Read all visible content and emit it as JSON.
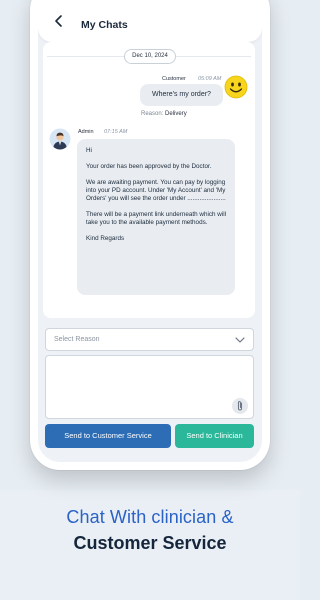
{
  "header": {
    "title": "My Chats",
    "back_icon": "chevron-left-icon"
  },
  "chat": {
    "date": "Dec 10, 2024",
    "customer_message": {
      "sender": "Customer",
      "time": "05:09 AM",
      "text": "Where's my order?",
      "reason_label": "Reason:",
      "reason_value": "Delivery",
      "avatar_icon": "smiley-face-icon"
    },
    "admin_message": {
      "sender": "Admin",
      "time": "07:15 AM",
      "avatar_icon": "admin-avatar-icon",
      "paragraphs": [
        "Hi",
        "Your order has been approved by the Doctor.",
        "We are awaiting payment. You can pay by logging into your PD account. Under 'My Account' and 'My Orders' you will see the order under ......................",
        "There will be a payment link underneath which will take you to the available payment methods.",
        "Kind Regards"
      ]
    }
  },
  "compose": {
    "select_placeholder": "Select Reason",
    "message_value": "",
    "attach_icon": "paperclip-icon"
  },
  "buttons": {
    "customer_service": "Send to Customer Service",
    "clinician": "Send to Clinician"
  },
  "tagline": {
    "line1": "Chat With clinician &",
    "line2": "Customer Service"
  },
  "colors": {
    "primary_blue": "#2c6db5",
    "clinician_green": "#2bb89a",
    "tagline_blue": "#2a62c6",
    "tagline_dark": "#15263c"
  }
}
